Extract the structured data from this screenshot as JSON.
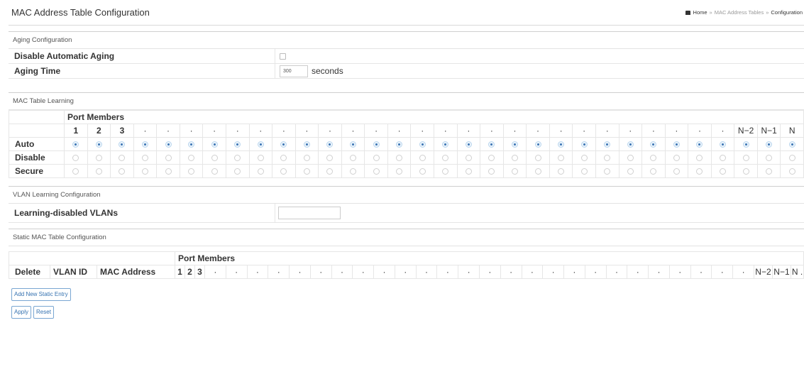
{
  "header": {
    "title": "MAC Address Table Configuration",
    "breadcrumb": {
      "home": "Home",
      "sep": "»",
      "middle": "MAC Address Tables",
      "current": "Configuration"
    }
  },
  "aging": {
    "section_title": "Aging Configuration",
    "disable_label": "Disable Automatic Aging",
    "disable_checked": false,
    "time_label": "Aging Time",
    "time_value": "300",
    "time_unit": "seconds"
  },
  "learning": {
    "section_title": "MAC Table Learning",
    "port_members_label": "Port Members",
    "ports_head": [
      "1",
      "2",
      "3"
    ],
    "ports_tail": [
      "N−2",
      "N−1",
      "N"
    ],
    "ellipsis_columns": 26,
    "ellipsis": "·",
    "rows": [
      {
        "label": "Auto",
        "selected": true
      },
      {
        "label": "Disable",
        "selected": false
      },
      {
        "label": "Secure",
        "selected": false
      }
    ]
  },
  "vlan": {
    "section_title": "VLAN Learning Configuration",
    "label": "Learning-disabled VLANs",
    "value": ""
  },
  "static": {
    "section_title": "Static MAC Table Configuration",
    "port_members_label": "Port Members",
    "col_delete": "Delete",
    "col_vlan": "VLAN ID",
    "col_mac": "MAC Address",
    "ports_head": [
      "1",
      "2",
      "3"
    ],
    "ports_tail": [
      "N−2",
      "N−1",
      "N ."
    ],
    "ellipsis": "·",
    "add_button": "Add New Static Entry"
  },
  "actions": {
    "apply": "Apply",
    "reset": "Reset"
  }
}
